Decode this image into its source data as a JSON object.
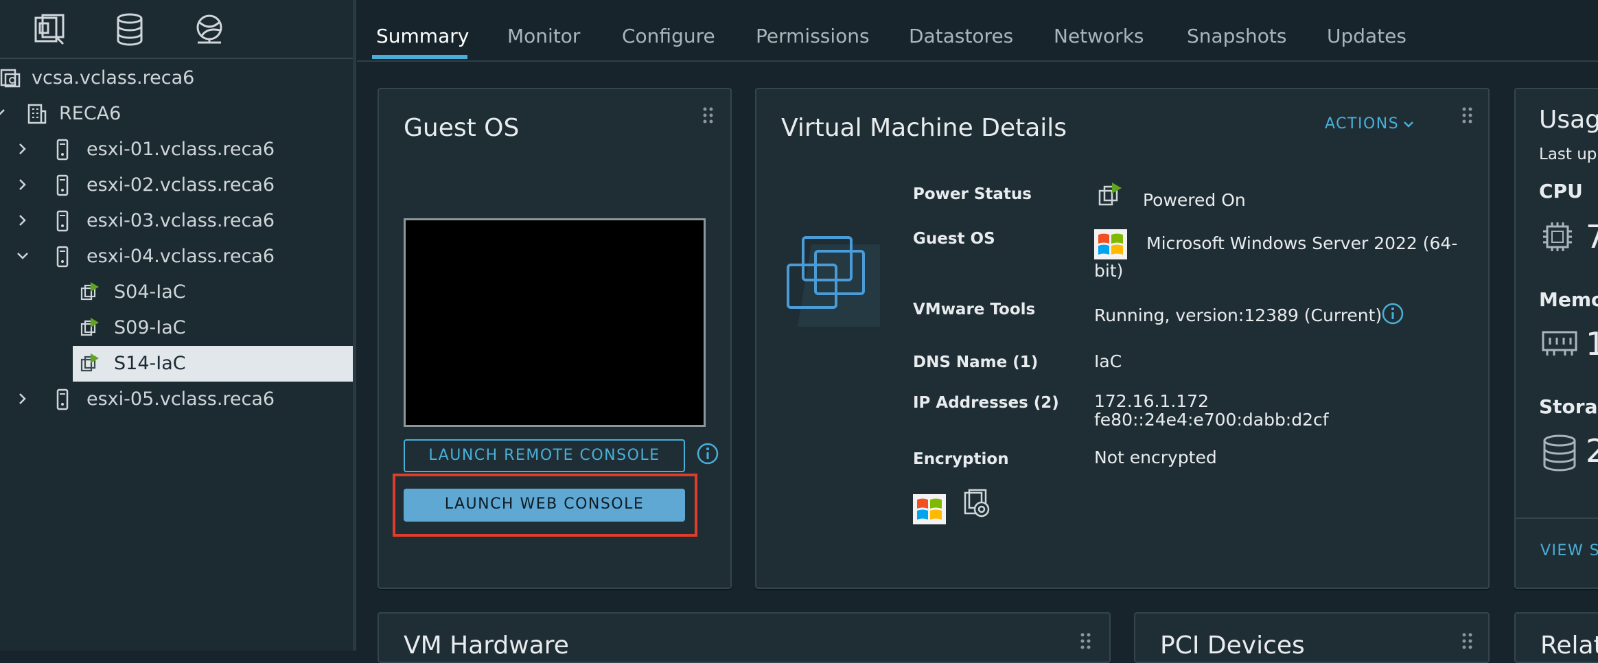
{
  "sidebar": {
    "top_icons": [
      "vms-templates-icon",
      "storage-icon",
      "networking-icon"
    ],
    "tree": [
      {
        "label": "vcsa.vclass.reca6",
        "icon": "vcenter-icon",
        "expand": "none"
      },
      {
        "label": "RECA6",
        "icon": "datacenter-icon",
        "expand": "none"
      },
      {
        "label": "esxi-01.vclass.reca6",
        "icon": "host-icon",
        "expand": "collapsed"
      },
      {
        "label": "esxi-02.vclass.reca6",
        "icon": "host-icon",
        "expand": "collapsed"
      },
      {
        "label": "esxi-03.vclass.reca6",
        "icon": "host-icon",
        "expand": "collapsed"
      },
      {
        "label": "esxi-04.vclass.reca6",
        "icon": "host-icon",
        "expand": "expanded"
      },
      {
        "label": "S04-IaC",
        "icon": "vm-powered-on-icon",
        "expand": "none"
      },
      {
        "label": "S09-IaC",
        "icon": "vm-powered-on-icon",
        "expand": "none"
      },
      {
        "label": "S14-IaC",
        "icon": "vm-powered-on-icon",
        "expand": "none",
        "selected": true
      },
      {
        "label": "esxi-05.vclass.reca6",
        "icon": "host-icon",
        "expand": "collapsed"
      }
    ]
  },
  "tabs": [
    "Summary",
    "Monitor",
    "Configure",
    "Permissions",
    "Datastores",
    "Networks",
    "Snapshots",
    "Updates"
  ],
  "active_tab": "Summary",
  "guest_os_card": {
    "title": "Guest OS",
    "launch_remote_console": "LAUNCH REMOTE CONSOLE",
    "launch_web_console": "LAUNCH WEB CONSOLE"
  },
  "vm_details_card": {
    "title": "Virtual Machine Details",
    "actions_label": "ACTIONS",
    "rows": {
      "power_status": {
        "key": "Power Status",
        "value": "Powered On"
      },
      "guest_os": {
        "key": "Guest OS",
        "value_line1": "Microsoft Windows Server 2022 (64-",
        "value_line2": "bit)"
      },
      "vmware_tools": {
        "key": "VMware Tools",
        "value": "Running, version:12389 (Current)"
      },
      "dns_name": {
        "key": "DNS Name (1)",
        "value": "IaC"
      },
      "ip_addresses": {
        "key": "IP Addresses (2)",
        "value_line1": "172.16.1.172",
        "value_line2": "fe80::24e4:e700:dabb:d2cf"
      },
      "encryption": {
        "key": "Encryption",
        "value": "Not encrypted"
      }
    }
  },
  "usage_card": {
    "title": "Usag",
    "subtitle": "Last up",
    "cpu_label": "CPU",
    "cpu_value": "7",
    "memory_label": "Memo",
    "memory_value": "1",
    "storage_label": "Storag",
    "storage_value": "2",
    "view_link": "VIEW S"
  },
  "bottom_cards": {
    "vm_hardware": "VM Hardware",
    "pci_devices": "PCI Devices",
    "related": "Relat"
  },
  "colors": {
    "accent": "#49afd9",
    "powered_on_green": "#62a420",
    "highlight_box": "#e03c2a"
  }
}
